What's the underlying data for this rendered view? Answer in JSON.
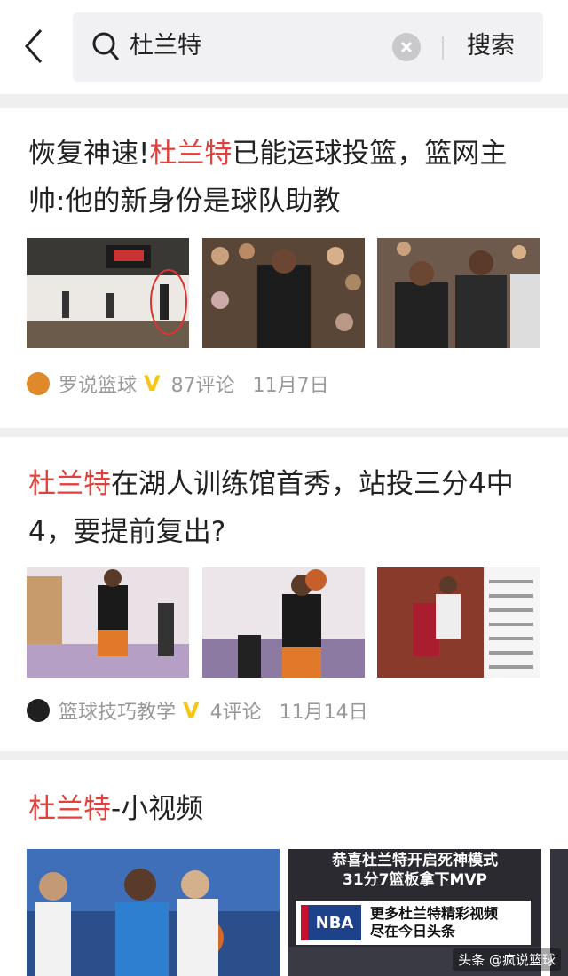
{
  "search": {
    "query": "杜兰特",
    "button_label": "搜索"
  },
  "articles": [
    {
      "title_highlight_pre": "恢复神速!",
      "title_keyword": "杜兰特",
      "title_rest": "已能运球投篮，篮网主帅:他的新身份是球队助教",
      "source": "罗说篮球",
      "comments": "87评论",
      "date": "11月7日"
    },
    {
      "title_keyword": "杜兰特",
      "title_rest": "在湖人训练馆首秀，站投三分4中4，要提前复出?",
      "source": "篮球技巧教学",
      "comments": "4评论",
      "date": "11月14日"
    }
  ],
  "videos": {
    "heading_keyword": "杜兰特",
    "heading_rest": "-小视频",
    "video2_caption_line1": "恭喜杜兰特开启死神模式",
    "video2_caption_line2": "31分7篮板拿下MVP",
    "promo_logo": "NBA",
    "promo_line1": "更多杜兰特精彩视频",
    "promo_line2": "尽在今日头条",
    "watermark": "头条 @疯说篮球"
  },
  "colors": {
    "highlight": "#e2403c",
    "verified_badge": "#f5c518"
  },
  "icons": [
    "back-arrow-icon",
    "search-icon",
    "clear-icon",
    "verified-v-icon"
  ]
}
